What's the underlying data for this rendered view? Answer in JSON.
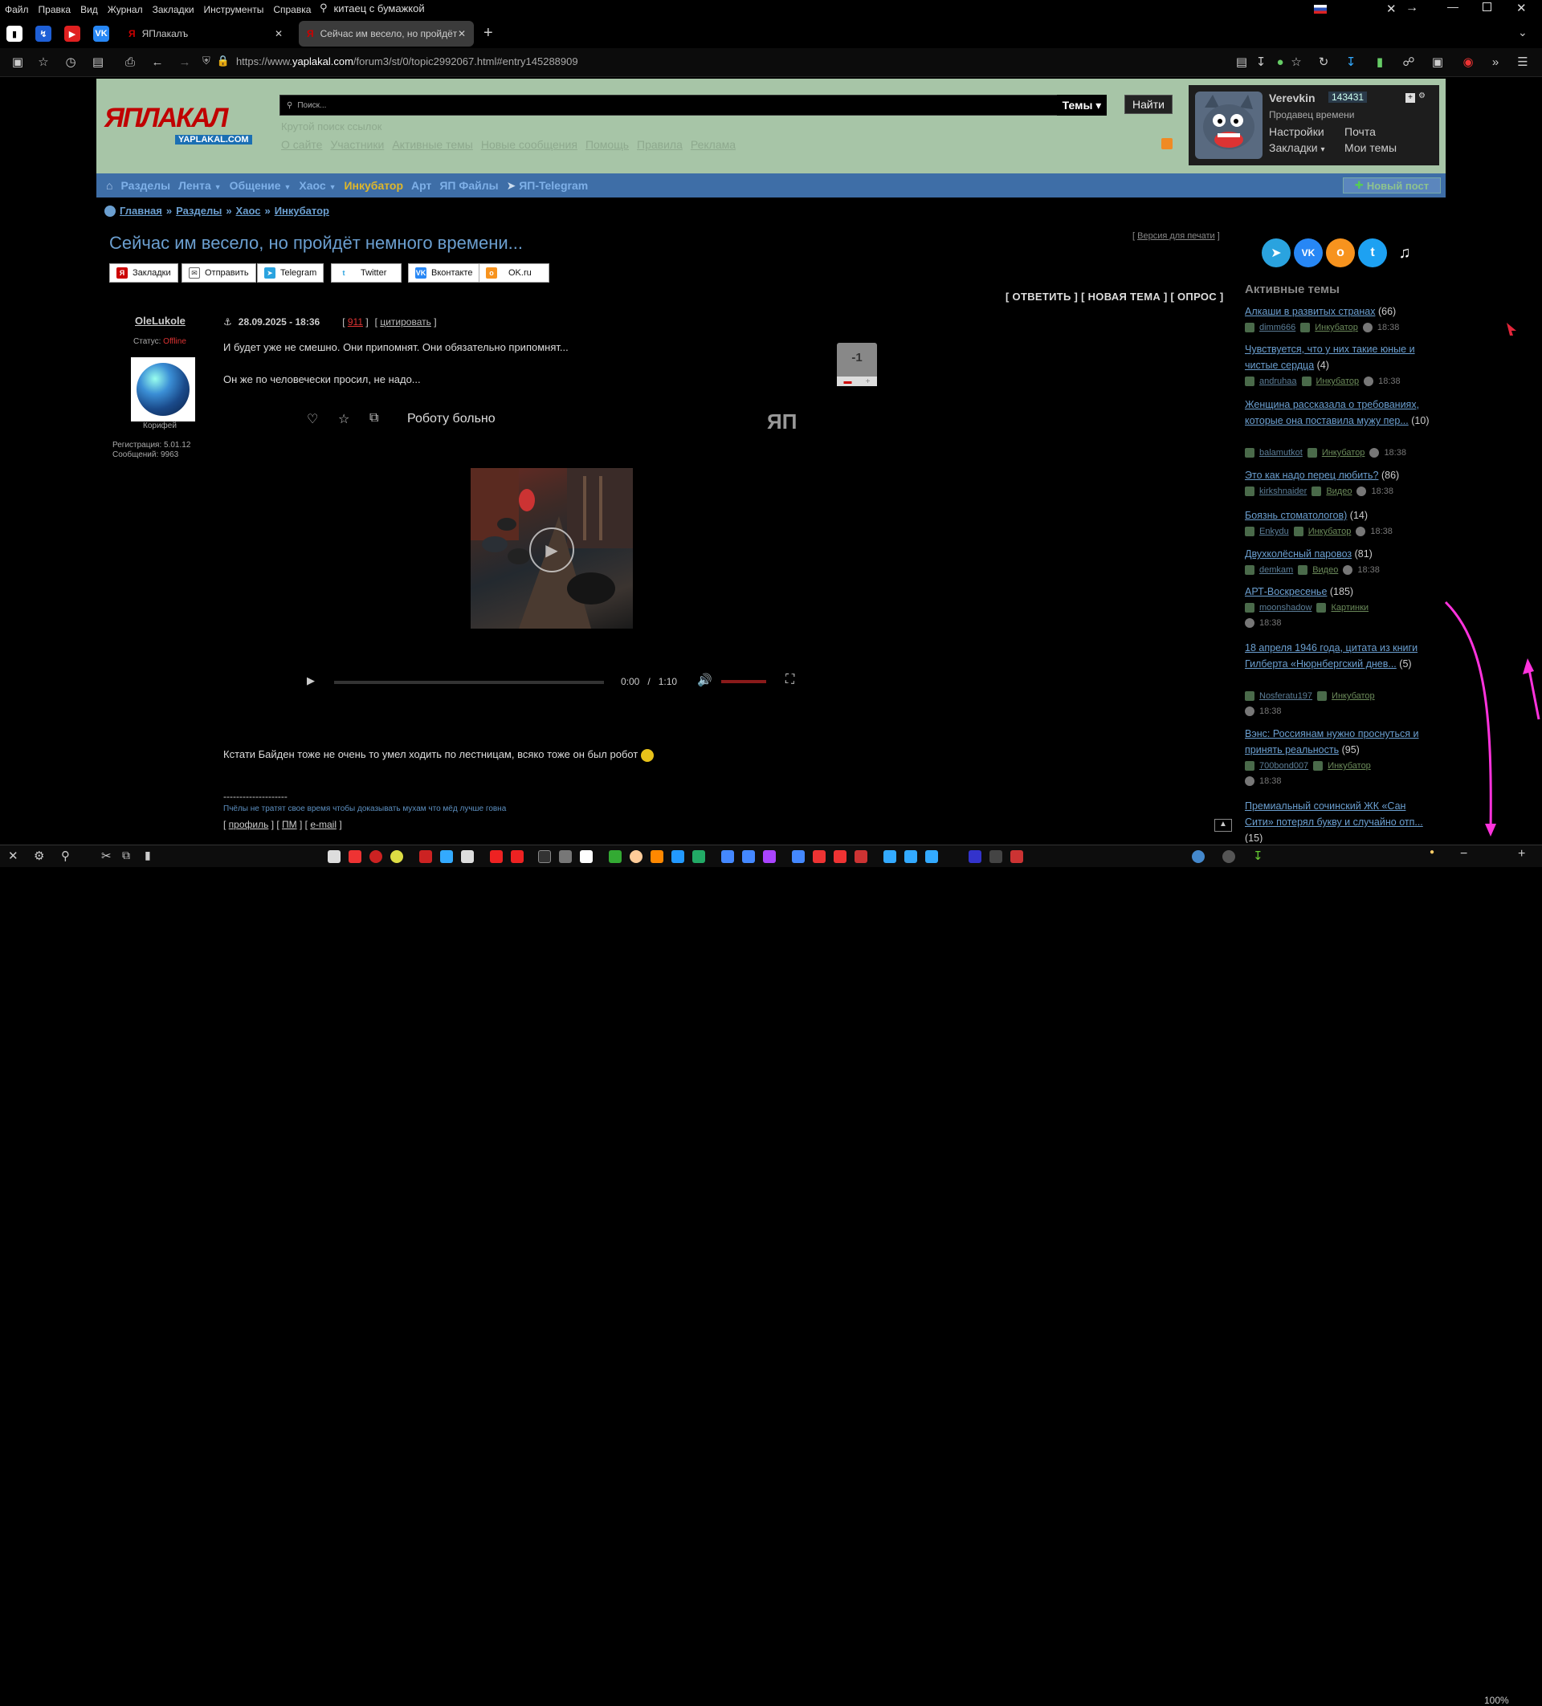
{
  "browser": {
    "menu": [
      "Файл",
      "Правка",
      "Вид",
      "Журнал",
      "Закладки",
      "Инструменты",
      "Справка"
    ],
    "search_query": "китаец с бумажкой",
    "tabs": [
      {
        "label": "ЯПлакалъ"
      },
      {
        "label": "Сейчас им весело, но пройдёт"
      }
    ],
    "url_prefix": "https://www.",
    "url_host": "yaplakal.com",
    "url_path": "/forum3/st/0/topic2992067.html#entry145288909",
    "zoom": "100%"
  },
  "site": {
    "logo_main": "ЯПЛАКАЛ",
    "logo_sub": "YAPLAKAL.COM",
    "search_placeholder": "Поиск...",
    "themes_label": "Темы",
    "find_label": "Найти",
    "search_hint": "Крутой поиск ссылок",
    "header_links": [
      "О сайте",
      "Участники",
      "Активные темы",
      "Новые сообщения",
      "Помощь",
      "Правила",
      "Реклама"
    ],
    "user": {
      "name": "Verevkin",
      "count": "143431",
      "status": "Продавец времени",
      "settings": "Настройки",
      "mail": "Почта",
      "bookmarks": "Закладки",
      "my_topics": "Мои темы"
    },
    "nav": [
      "Разделы",
      "Лента",
      "Общение",
      "Хаос",
      "Инкубатор",
      "Арт",
      "ЯП Файлы",
      "ЯП-Telegram"
    ],
    "new_post": "Новый пост"
  },
  "breadcrumb": [
    "Главная",
    "Разделы",
    "Хаос",
    "Инкубатор"
  ],
  "topic": {
    "title": "Сейчас им весело, но пройдёт немного времени...",
    "print_version": "Версия для печати",
    "share": [
      "Закладки",
      "Отправить",
      "Telegram",
      "Twitter",
      "Вконтакте",
      "OK.ru"
    ],
    "actions": "[ ОТВЕТИТЬ ] [ НОВАЯ ТЕМА ] [ ОПРОС ]"
  },
  "post": {
    "author": "OleLukole",
    "status_label": "Статус:",
    "status_value": "Offline",
    "rank": "Корифей",
    "registration": "Регистрация: 5.01.12",
    "messages": "Сообщений: 9963",
    "date": "28.09.2025 - 18:36",
    "number": "911",
    "quote": "цитировать",
    "text1": "И будет уже не смешно. Они припомнят. Они обязательно припомнят...",
    "text2": "Он же по человечески просил, не надо...",
    "rating": "-1",
    "video_title": "Роботу больно",
    "video_time_current": "0:00",
    "video_time_total": "1:10",
    "text3": "Кстати Байден тоже не очень то умел ходить по лестницам, всяко тоже он был робот",
    "sig_line": "--------------------",
    "signature": "Пчёлы не тратят свое время чтобы доказывать мухам что мёд лучше говна",
    "profile_links": [
      "профиль",
      "ПМ",
      "e-mail"
    ]
  },
  "sidebar": {
    "active_title": "Активные темы",
    "items": [
      {
        "title": "Алкаши в развитых странах",
        "count": "(66)",
        "user": "dimm666",
        "section": "Инкубатор",
        "time": "18:38"
      },
      {
        "title": "Чувствуется, что у них такие юные и чистые сердца",
        "count": "(4)",
        "user": "andruhaa",
        "section": "Инкубатор",
        "time": "18:38"
      },
      {
        "title": "Женщина рассказала о требованиях, которые она поставила мужу пер...",
        "count": "(10)",
        "user": "balamutkot",
        "section": "Инкубатор",
        "time": "18:38"
      },
      {
        "title": "Это как надо перец любить?",
        "count": "(86)",
        "user": "kirkshnaider",
        "section": "Видео",
        "time": "18:38"
      },
      {
        "title": "Боязнь стоматологов)",
        "count": "(14)",
        "user": "Enkydu",
        "section": "Инкубатор",
        "time": "18:38"
      },
      {
        "title": "Двухколёсный паровоз",
        "count": "(81)",
        "user": "demkam",
        "section": "Видео",
        "time": "18:38"
      },
      {
        "title": "АРТ-Воскресенье",
        "count": "(185)",
        "user": "moonshadow",
        "section": "Картинки",
        "time": "18:38"
      },
      {
        "title": "18 апреля 1946 года, цитата из книги Гилберта «Нюрнбергский днев...",
        "count": "(5)",
        "user": "Nosferatu197",
        "section": "Инкубатор",
        "time": "18:38"
      },
      {
        "title": "Вэнс: Россиянам нужно проснуться и принять реальность",
        "count": "(95)",
        "user": "700bond007",
        "section": "Инкубатор",
        "time": "18:38"
      },
      {
        "title": "Премиальный сочинский ЖК «Сан Сити» потерял букву и случайно отп...",
        "count": "(15)",
        "user": "",
        "section": "",
        "time": ""
      }
    ]
  },
  "colors": {
    "accent": "#6b9fd0",
    "header_bg": "#a7c5a7",
    "nav_bg": "#3e6ea7",
    "incubator": "#dfb72a",
    "annotation": "#ff33dd"
  }
}
